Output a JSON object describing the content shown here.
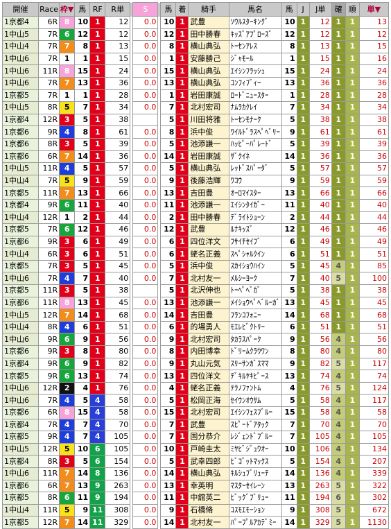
{
  "headers": {
    "venue": "開催",
    "race": "Race",
    "waku": "枠",
    "umaban": "馬",
    "rf": "RF",
    "rtan": "R単",
    "s": "S",
    "uma2": "馬",
    "chaku": "着",
    "jockey": "騎手",
    "horse": "馬名",
    "uma3": "馬",
    "j": "J",
    "jtan": "J単",
    "kaku": "確",
    "jun": "順",
    "tan": "単"
  },
  "waku_colors": {
    "1": "#ffffff",
    "2": "#111111",
    "3": "#e0001a",
    "4": "#1f3ed9",
    "5": "#f7e21c",
    "6": "#18a53c",
    "7": "#f28c1b",
    "8": "#f5a3d9"
  },
  "rows": [
    {
      "venue": "1京都4",
      "race": "6R",
      "waku": 8,
      "uma": "10",
      "rf": "1",
      "rtan": "12",
      "s": "0.0",
      "uma2": "10",
      "chaku": "1",
      "jockey": "武豊",
      "horse": "ｿｳﾙｽﾀｰｷﾝｸﾞ",
      "uma3": "10",
      "j": "1",
      "jtan": "12",
      "kaku": "1",
      "jun": "1",
      "tan": "13"
    },
    {
      "venue": "1中山5",
      "race": "7R",
      "waku": 6,
      "uma": "12",
      "rf": "1",
      "rtan": "12",
      "s": "0.0",
      "uma2": "12",
      "chaku": "1",
      "jockey": "田中勝春",
      "horse": "ｷｯｽﾞｱﾌﾟﾛｰｽﾞ",
      "uma3": "12",
      "j": "1",
      "jtan": "12",
      "kaku": "1",
      "jun": "1",
      "tan": "12"
    },
    {
      "venue": "1中山4",
      "race": "7R",
      "waku": 7,
      "uma": "8",
      "rf": "1",
      "rtan": "13",
      "s": "0.0",
      "uma2": "8",
      "chaku": "1",
      "jockey": "横山典弘",
      "horse": "ﾄｰｾﾝｱﾚｽ",
      "uma3": "8",
      "j": "1",
      "jtan": "13",
      "kaku": "1",
      "jun": "1",
      "tan": "15"
    },
    {
      "venue": "1中山6",
      "race": "7R",
      "waku": 1,
      "uma": "1",
      "rf": "1",
      "rtan": "15",
      "s": "0.0",
      "uma2": "1",
      "chaku": "1",
      "jockey": "安藤勝己",
      "horse": "ｼﾞｬﾓｰﾙ",
      "uma3": "1",
      "j": "1",
      "jtan": "15",
      "kaku": "1",
      "jun": "1",
      "tan": "16"
    },
    {
      "venue": "1中山6",
      "race": "11R",
      "waku": 8,
      "uma": "15",
      "rf": "1",
      "rtan": "24",
      "s": "0.0",
      "uma2": "15",
      "chaku": "1",
      "jockey": "横山典弘",
      "horse": "ｴｲｼﾝﾌﾗｯｼｭ",
      "uma3": "15",
      "j": "1",
      "jtan": "24",
      "kaku": "1",
      "jun": "1",
      "tan": "24"
    },
    {
      "venue": "1中山6",
      "race": "7R",
      "waku": 7,
      "uma": "13",
      "rf": "1",
      "rtan": "36",
      "s": "0.0",
      "uma2": "13",
      "chaku": "1",
      "jockey": "横山典弘",
      "horse": "ｺﾝﾌｨﾌﾞｨｰ",
      "uma3": "13",
      "j": "1",
      "jtan": "36",
      "kaku": "1",
      "jun": "1",
      "tan": "36"
    },
    {
      "venue": "1京都5",
      "race": "7R",
      "waku": 1,
      "uma": "1",
      "rf": "1",
      "rtan": "28",
      "s": "0.0",
      "uma2": "1",
      "chaku": "1",
      "jockey": "岩田康誠",
      "horse": "ﾛｰﾄﾞﾆｭｰｽﾀｰ",
      "uma3": "1",
      "j": "1",
      "jtan": "28",
      "kaku": "1",
      "jun": "1",
      "tan": "28"
    },
    {
      "venue": "1中山5",
      "race": "8R",
      "waku": 5,
      "uma": "7",
      "rf": "1",
      "rtan": "34",
      "s": "0.0",
      "uma2": "7",
      "chaku": "1",
      "jockey": "北村宏司",
      "horse": "ﾅﾑﾗｶｸﾚｲ",
      "uma3": "7",
      "j": "1",
      "jtan": "34",
      "kaku": "1",
      "jun": "1",
      "tan": "34"
    },
    {
      "venue": "1京都4",
      "race": "12R",
      "waku": 3,
      "uma": "5",
      "rf": "1",
      "rtan": "38",
      "s": "",
      "uma2": "5",
      "chaku": "1",
      "jockey": "川田将雅",
      "horse": "ﾄｰｾﾝﾓﾅｰｸ",
      "uma3": "5",
      "j": "1",
      "jtan": "38",
      "kaku": "1",
      "jun": "1",
      "tan": "38"
    },
    {
      "venue": "1京都6",
      "race": "9R",
      "waku": 4,
      "uma": "8",
      "rf": "1",
      "rtan": "61",
      "s": "0.0",
      "uma2": "8",
      "chaku": "1",
      "jockey": "浜中俊",
      "horse": "ﾜｲﾙﾄﾞﾗｽﾍﾟﾍﾞﾘｰ",
      "uma3": "9",
      "j": "1",
      "jtan": "61",
      "kaku": "1",
      "jun": "1",
      "tan": "61"
    },
    {
      "venue": "1京都6",
      "race": "8R",
      "waku": 3,
      "uma": "5",
      "rf": "1",
      "rtan": "39",
      "s": "0.0",
      "uma2": "5",
      "chaku": "1",
      "jockey": "池添謙一",
      "horse": "ﾊｯﾋﾟｰﾊﾟﾚｰﾄﾞ",
      "uma3": "5",
      "j": "1",
      "jtan": "39",
      "kaku": "1",
      "jun": "1",
      "tan": "39"
    },
    {
      "venue": "1京都6",
      "race": "6R",
      "waku": 7,
      "uma": "14",
      "rf": "1",
      "rtan": "36",
      "s": "0.0",
      "uma2": "14",
      "chaku": "1",
      "jockey": "岩田康誠",
      "horse": "ｻﾞｸｲﾈ",
      "uma3": "14",
      "j": "1",
      "jtan": "36",
      "kaku": "1",
      "jun": "1",
      "tan": "36"
    },
    {
      "venue": "1中山5",
      "race": "11R",
      "waku": 4,
      "uma": "5",
      "rf": "1",
      "rtan": "57",
      "s": "0.0",
      "uma2": "5",
      "chaku": "1",
      "jockey": "横山典弘",
      "horse": "ﾚｯﾄﾞｽﾊﾟｰﾀﾞ",
      "uma3": "5",
      "j": "1",
      "jtan": "57",
      "kaku": "1",
      "jun": "1",
      "tan": "57"
    },
    {
      "venue": "1中山4",
      "race": "7R",
      "waku": 5,
      "uma": "9",
      "rf": "1",
      "rtan": "59",
      "s": "0.0",
      "uma2": "9",
      "chaku": "1",
      "jockey": "後藤浩輝",
      "horse": "ﾜｺｳ",
      "uma3": "9",
      "j": "1",
      "jtan": "59",
      "kaku": "1",
      "jun": "1",
      "tan": "59"
    },
    {
      "venue": "1京都5",
      "race": "11R",
      "waku": 7,
      "uma": "13",
      "rf": "1",
      "rtan": "66",
      "s": "0.0",
      "uma2": "13",
      "chaku": "1",
      "jockey": "吉田豊",
      "horse": "ｵｰﾛﾏｲｽﾀｰ",
      "uma3": "13",
      "j": "1",
      "jtan": "66",
      "kaku": "1",
      "jun": "1",
      "tan": "66"
    },
    {
      "venue": "1京都4",
      "race": "9R",
      "waku": 6,
      "uma": "11",
      "rf": "1",
      "rtan": "40",
      "s": "0.0",
      "uma2": "11",
      "chaku": "1",
      "jockey": "池添謙一",
      "horse": "ｴｲｼﾝﾀｲｶﾞｰ",
      "uma3": "11",
      "j": "1",
      "jtan": "40",
      "kaku": "1",
      "jun": "1",
      "tan": "40"
    },
    {
      "venue": "1中山4",
      "race": "12R",
      "waku": 1,
      "uma": "2",
      "rf": "1",
      "rtan": "44",
      "s": "0.0",
      "uma2": "2",
      "chaku": "1",
      "jockey": "田中勝春",
      "horse": "ﾃﾞﾗｲﾄｼｮｰﾝ",
      "uma3": "2",
      "j": "1",
      "jtan": "44",
      "kaku": "1",
      "jun": "1",
      "tan": "44"
    },
    {
      "venue": "1京都5",
      "race": "7R",
      "waku": 6,
      "uma": "12",
      "rf": "1",
      "rtan": "46",
      "s": "0.0",
      "uma2": "12",
      "chaku": "1",
      "jockey": "武豊",
      "horse": "ﾙﾅｷｯｽﾞ",
      "uma3": "12",
      "j": "1",
      "jtan": "46",
      "kaku": "1",
      "jun": "1",
      "tan": "46"
    },
    {
      "venue": "1京都6",
      "race": "9R",
      "waku": 3,
      "uma": "6",
      "rf": "1",
      "rtan": "49",
      "s": "0.0",
      "uma2": "6",
      "chaku": "1",
      "jockey": "四位洋文",
      "horse": "ﾌｻｲﾁｾｲﾌﾞ",
      "uma3": "6",
      "j": "1",
      "jtan": "49",
      "kaku": "1",
      "jun": "1",
      "tan": "49"
    },
    {
      "venue": "1中山4",
      "race": "6R",
      "waku": 3,
      "uma": "6",
      "rf": "1",
      "rtan": "51",
      "s": "0.0",
      "uma2": "6",
      "chaku": "1",
      "jockey": "蛯名正義",
      "horse": "ｽﾍﾟｼｬﾙｸｲﾝ",
      "uma3": "6",
      "j": "1",
      "jtan": "51",
      "kaku": "1",
      "jun": "1",
      "tan": "51"
    },
    {
      "venue": "1京都5",
      "race": "7R",
      "waku": 3,
      "uma": "5",
      "rf": "1",
      "rtan": "45",
      "s": "0.0",
      "uma2": "5",
      "chaku": "1",
      "jockey": "浜中俊",
      "horse": "ｽｶｲｼｮｳﾊｲﾝ",
      "uma3": "5",
      "j": "1",
      "jtan": "45",
      "kaku": "4",
      "jun": "1",
      "tan": "85"
    },
    {
      "venue": "1中山6",
      "race": "7R",
      "waku": 4,
      "uma": "7",
      "rf": "1",
      "rtan": "40",
      "s": "0.0",
      "uma2": "7",
      "chaku": "1",
      "jockey": "北村友一",
      "horse": "ﾒﾙｼｰﾖｰｸ",
      "uma3": "7",
      "j": "1",
      "jtan": "40",
      "kaku": "5",
      "jun": "1",
      "tan": "100"
    },
    {
      "venue": "1京都5",
      "race": "11R",
      "waku": 3,
      "uma": "5",
      "rf": "1",
      "rtan": "38",
      "s": "",
      "uma2": "5",
      "chaku": "1",
      "jockey": "北沢伸也",
      "horse": "ﾄｰﾍﾟﾍﾞｶﾞ",
      "uma3": "5",
      "j": "1",
      "jtan": "38",
      "kaku": "1",
      "jun": "1",
      "tan": "38"
    },
    {
      "venue": "1京都6",
      "race": "11R",
      "waku": 8,
      "uma": "13",
      "rf": "1",
      "rtan": "45",
      "s": "0.0",
      "uma2": "13",
      "chaku": "1",
      "jockey": "池添謙一",
      "horse": "ﾒｲｼｮｳﾍﾟﾍﾞﾙｰｶﾞ",
      "uma3": "13",
      "j": "1",
      "jtan": "45",
      "kaku": "1",
      "jun": "1",
      "tan": "45"
    },
    {
      "venue": "1中山5",
      "race": "12R",
      "waku": 7,
      "uma": "14",
      "rf": "1",
      "rtan": "68",
      "s": "0.0",
      "uma2": "14",
      "chaku": "1",
      "jockey": "吉田豊",
      "horse": "ﾌﾗﾝｺﾌｫﾆｰ",
      "uma3": "14",
      "j": "1",
      "jtan": "68",
      "kaku": "1",
      "jun": "1",
      "tan": "68"
    },
    {
      "venue": "1中山4",
      "race": "8R",
      "waku": 4,
      "uma": "6",
      "rf": "1",
      "rtan": "51",
      "s": "0.0",
      "uma2": "6",
      "chaku": "1",
      "jockey": "的場勇人",
      "horse": "ﾓｴﾚﾋﾞｸﾄﾘｰ",
      "uma3": "6",
      "j": "1",
      "jtan": "51",
      "kaku": "1",
      "jun": "1",
      "tan": "51"
    },
    {
      "venue": "1中山6",
      "race": "9R",
      "waku": 6,
      "uma": "9",
      "rf": "1",
      "rtan": "56",
      "s": "0.0",
      "uma2": "9",
      "chaku": "1",
      "jockey": "北村宏司",
      "horse": "ﾀｶﾗｽﾊﾟｰｸ",
      "uma3": "9",
      "j": "1",
      "jtan": "56",
      "kaku": "4",
      "jun": "1",
      "tan": "56"
    },
    {
      "venue": "1京都6",
      "race": "9R",
      "waku": 3,
      "uma": "8",
      "rf": "1",
      "rtan": "80",
      "s": "0.0",
      "uma2": "8",
      "chaku": "1",
      "jockey": "内田博幸",
      "horse": "ﾄﾞﾘｰﾑｸﾗｳﾜﾝ",
      "uma3": "8",
      "j": "1",
      "jtan": "80",
      "kaku": "4",
      "jun": "1",
      "tan": "80"
    },
    {
      "venue": "1京都4",
      "race": "9R",
      "waku": 6,
      "uma": "9",
      "rf": "1",
      "rtan": "82",
      "s": "0.0",
      "uma2": "9",
      "chaku": "1",
      "jockey": "丸山元気",
      "horse": "ｽﾘｰｻﾝｶﾞｽﾏﾏ",
      "uma3": "9",
      "j": "1",
      "jtan": "82",
      "kaku": "5",
      "jun": "1",
      "tan": "117"
    },
    {
      "venue": "1京都5",
      "race": "9R",
      "waku": 6,
      "uma": "13",
      "rf": "1",
      "rtan": "74",
      "s": "0.0",
      "uma2": "13",
      "chaku": "1",
      "jockey": "四位洋文",
      "horse": "ﾃﾞｷﾙﾔｷﾋﾟｰｽ",
      "uma3": "13",
      "j": "1",
      "jtan": "74",
      "kaku": "4",
      "jun": "1",
      "tan": "74"
    },
    {
      "venue": "1中山6",
      "race": "12R",
      "waku": 2,
      "uma": "4",
      "rf": "1",
      "rtan": "76",
      "s": "0.0",
      "uma2": "4",
      "chaku": "1",
      "jockey": "蛯名正義",
      "horse": "ﾃﾗﾉﾌｧﾝﾄﾑ",
      "uma3": "4",
      "j": "1",
      "jtan": "76",
      "kaku": "5",
      "jun": "1",
      "tan": "124"
    },
    {
      "venue": "1中山6",
      "race": "7R",
      "waku": 4,
      "uma": "5",
      "rf": "4",
      "rtan": "58",
      "s": "0.0",
      "uma2": "5",
      "chaku": "1",
      "jockey": "松岡正海",
      "horse": "ｾｲｳﾝｵｳｻﾑ",
      "uma3": "5",
      "j": "1",
      "jtan": "58",
      "kaku": "4",
      "jun": "1",
      "tan": "117"
    },
    {
      "venue": "1京都6",
      "race": "6R",
      "waku": 8,
      "uma": "15",
      "rf": "4",
      "rtan": "58",
      "s": "0.0",
      "uma2": "15",
      "chaku": "1",
      "jockey": "北村宏司",
      "horse": "ｴｲｼﾝﾌｪｽﾌﾞﾙｰ",
      "uma3": "15",
      "j": "1",
      "jtan": "58",
      "kaku": "4",
      "jun": "1",
      "tan": "58"
    },
    {
      "venue": "1京都4",
      "race": "7R",
      "waku": 4,
      "uma": "7",
      "rf": "4",
      "rtan": "70",
      "s": "0.0",
      "uma2": "7",
      "chaku": "1",
      "jockey": "武豊",
      "horse": "ｽﾋﾟｰﾄﾞｱﾀｯｸ",
      "uma3": "7",
      "j": "1",
      "jtan": "70",
      "kaku": "4",
      "jun": "1",
      "tan": "70"
    },
    {
      "venue": "1京都5",
      "race": "9R",
      "waku": 4,
      "uma": "7",
      "rf": "4",
      "rtan": "105",
      "s": "0.0",
      "uma2": "7",
      "chaku": "1",
      "jockey": "国分恭介",
      "horse": "ﾚｼﾞｪﾝﾄﾞﾌﾞﾙｰ",
      "uma3": "7",
      "j": "1",
      "jtan": "105",
      "kaku": "4",
      "jun": "1",
      "tan": "105"
    },
    {
      "venue": "1中山5",
      "race": "12R",
      "waku": 5,
      "uma": "10",
      "rf": "6",
      "rtan": "105",
      "s": "0.0",
      "uma2": "10",
      "chaku": "1",
      "jockey": "戸崎圭太",
      "horse": "ﾐﾔﾋﾞｼﾞｭｳｵｰ",
      "uma3": "10",
      "j": "1",
      "jtan": "106",
      "kaku": "4",
      "jun": "1",
      "tan": "134"
    },
    {
      "venue": "1京都4",
      "race": "8R",
      "waku": 3,
      "uma": "5",
      "rf": "6",
      "rtan": "154",
      "s": "0.0",
      "uma2": "5",
      "chaku": "1",
      "jockey": "武幸四郎",
      "horse": "ﾋﾞｺﾞｯﾄﾏｯｸｽ",
      "uma3": "5",
      "j": "1",
      "jtan": "154",
      "kaku": "4",
      "jun": "1",
      "tan": "207"
    },
    {
      "venue": "1中山6",
      "race": "11R",
      "waku": 7,
      "uma": "14",
      "rf": "8",
      "rtan": "136",
      "s": "0.0",
      "uma2": "14",
      "chaku": "1",
      "jockey": "横山典弘",
      "horse": "ｷﾙｼｭﾌﾞﾘｭｰﾃ",
      "uma3": "14",
      "j": "1",
      "jtan": "136",
      "kaku": "4",
      "jun": "1",
      "tan": "339"
    },
    {
      "venue": "1京都6",
      "race": "6R",
      "waku": 7,
      "uma": "13",
      "rf": "9",
      "rtan": "263",
      "s": "0.0",
      "uma2": "13",
      "chaku": "1",
      "jockey": "幸英明",
      "horse": "ﾏｽﾀｰｾｲﾚｰﾝ",
      "uma3": "13",
      "j": "1",
      "jtan": "263",
      "kaku": "5",
      "jun": "1",
      "tan": "322"
    },
    {
      "venue": "1京都5",
      "race": "8R",
      "waku": 6,
      "uma": "11",
      "rf": "9",
      "rtan": "194",
      "s": "0.0",
      "uma2": "11",
      "chaku": "1",
      "jockey": "中舘英二",
      "horse": "ﾋﾞｯｸﾞﾌﾞﾘｭｰ",
      "uma3": "11",
      "j": "1",
      "jtan": "194",
      "kaku": "6",
      "jun": "1",
      "tan": "302"
    },
    {
      "venue": "1中山4",
      "race": "11R",
      "waku": 5,
      "uma": "9",
      "rf": "11",
      "rtan": "308",
      "s": "0.0",
      "uma2": "9",
      "chaku": "1",
      "jockey": "石橋脩",
      "horse": "ｺｽﾓｴﾓｰｼｮﾝ",
      "uma3": "9",
      "j": "1",
      "jtan": "308",
      "kaku": "5",
      "jun": "1",
      "tan": "672"
    },
    {
      "venue": "1京都5",
      "race": "12R",
      "waku": 7,
      "uma": "14",
      "rf": "11",
      "rtan": "329",
      "s": "0.0",
      "uma2": "14",
      "chaku": "1",
      "jockey": "北村友一",
      "horse": "ﾊﾟｰﾌﾟﾙｱｶﾃﾞﾐｰ",
      "uma3": "14",
      "j": "1",
      "jtan": "329",
      "kaku": "5",
      "jun": "1",
      "tan": "1130"
    }
  ]
}
